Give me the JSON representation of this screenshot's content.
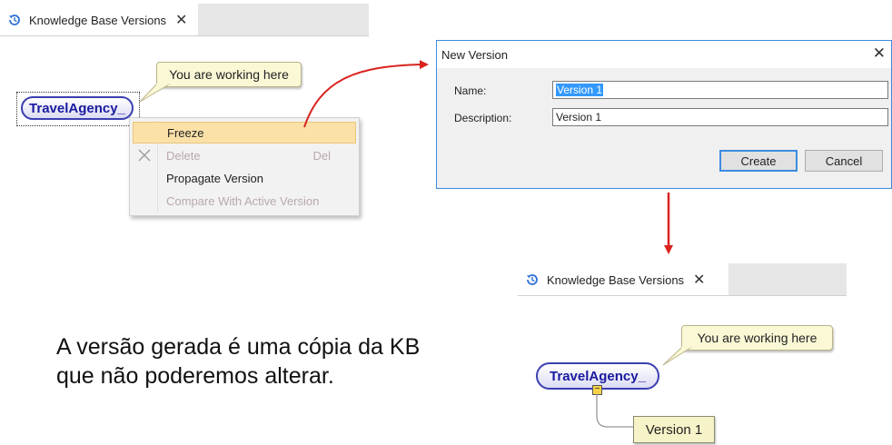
{
  "top_tab": {
    "label": "Knowledge Base Versions",
    "close": "✕"
  },
  "top_callout": {
    "text": "You are working here"
  },
  "top_node": {
    "label": "TravelAgency_"
  },
  "context_menu": {
    "items": [
      {
        "label": "Freeze",
        "shortcut": "",
        "state": "highlighted"
      },
      {
        "label": "Delete",
        "shortcut": "Del",
        "state": "disabled",
        "icon": "delete-x-icon"
      },
      {
        "label": "Propagate Version",
        "shortcut": "",
        "state": "normal"
      },
      {
        "label": "Compare With Active Version",
        "shortcut": "",
        "state": "disabled"
      }
    ]
  },
  "dialog": {
    "title": "New Version",
    "close": "✕",
    "name_label": "Name:",
    "name_value": "Version 1",
    "description_label": "Description:",
    "description_value": "Version 1",
    "create_label": "Create",
    "cancel_label": "Cancel"
  },
  "bottom_tab": {
    "label": "Knowledge Base Versions",
    "close": "✕"
  },
  "bottom_callout": {
    "text": "You are working here"
  },
  "bottom_node": {
    "label": "TravelAgency_",
    "collapse_glyph": "−"
  },
  "child_version": {
    "label": "Version 1"
  },
  "caption": {
    "line1": "A versão gerada é uma cópia da KB",
    "line2": "que não poderemos alterar."
  },
  "colors": {
    "arrow": "#d9231f",
    "node_border": "#3b3fb0",
    "highlight": "#fbe1a8",
    "accent": "#3c8be0"
  }
}
